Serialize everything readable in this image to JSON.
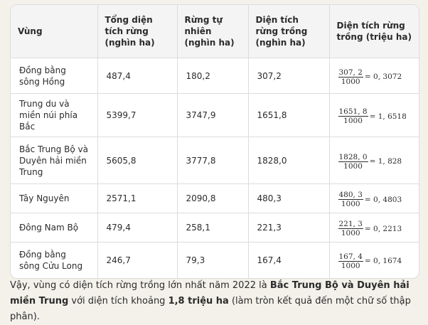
{
  "table": {
    "headers": [
      "Vùng",
      "Tổng diện tích rừng (nghìn ha)",
      "Rừng tự nhiên (nghìn ha)",
      "Diện tích rừng trồng (nghìn ha)",
      "Diện tích rừng trồng (triệu ha)"
    ],
    "rows": [
      {
        "region": "Đồng bằng sông Hồng",
        "total": "487,4",
        "natural": "180,2",
        "planted": "307,2",
        "frac_num": "307, 2",
        "frac_den": "1000",
        "frac_rest": "= 0, 3072"
      },
      {
        "region": "Trung du và miền núi phía Bắc",
        "total": "5399,7",
        "natural": "3747,9",
        "planted": "1651,8",
        "frac_num": "1651, 8",
        "frac_den": "1000",
        "frac_rest": "= 1, 6518"
      },
      {
        "region": "Bắc Trung Bộ và Duyên hải miền Trung",
        "total": "5605,8",
        "natural": "3777,8",
        "planted": "1828,0",
        "frac_num": "1828, 0",
        "frac_den": "1000",
        "frac_rest": "= 1, 828"
      },
      {
        "region": "Tây Nguyên",
        "total": "2571,1",
        "natural": "2090,8",
        "planted": "480,3",
        "frac_num": "480, 3",
        "frac_den": "1000",
        "frac_rest": "= 0, 4803"
      },
      {
        "region": "Đông Nam Bộ",
        "total": "479,4",
        "natural": "258,1",
        "planted": "221,3",
        "frac_num": "221, 3",
        "frac_den": "1000",
        "frac_rest": "= 0, 2213"
      },
      {
        "region": "Đồng bằng sông Cửu Long",
        "total": "246,7",
        "natural": "79,3",
        "planted": "167,4",
        "frac_num": "167, 4",
        "frac_den": "1000",
        "frac_rest": "= 0, 1674"
      }
    ]
  },
  "conclusion": {
    "part1": "Vậy, vùng có diện tích rừng trồng lớn nhất năm 2022 là ",
    "region": "Bắc Trung Bộ và Duyên hải miền Trung",
    "part2": " với diện tích khoảng ",
    "amount": "1,8 triệu ha",
    "part3": " (làm tròn kết quả đến một chữ số thập phân)."
  }
}
